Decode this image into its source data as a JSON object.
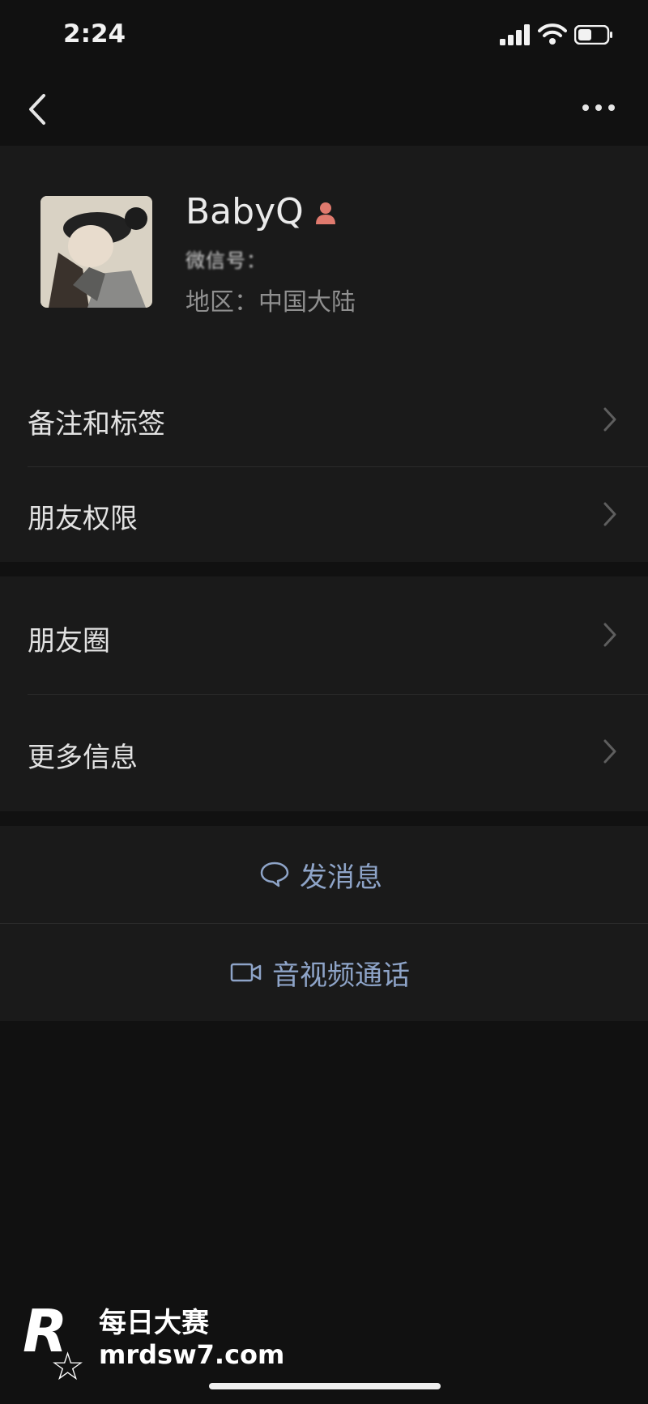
{
  "status_bar": {
    "time": "2:24"
  },
  "profile": {
    "name": "BabyQ",
    "wechat_id": "微信号：",
    "region": "地区：中国大陆"
  },
  "menu_group_1": [
    {
      "label": "备注和标签"
    },
    {
      "label": "朋友权限"
    }
  ],
  "menu_group_2": [
    {
      "label": "朋友圈"
    },
    {
      "label": "更多信息"
    }
  ],
  "actions": {
    "send_message": "发消息",
    "av_call": "音视频通话"
  },
  "watermark": {
    "brand": "每日大赛",
    "url": "mrdsw7.com",
    "logo_letter": "R"
  },
  "colors": {
    "background": "#111111",
    "card": "#1a1a1a",
    "link": "#8ea4c8",
    "gender_female": "#e07a6e"
  },
  "icons": [
    "back-icon",
    "more-icon",
    "signal-icon",
    "wifi-icon",
    "battery-icon",
    "gender-female-icon",
    "chevron-right-icon",
    "chat-bubble-icon",
    "video-camera-icon"
  ]
}
